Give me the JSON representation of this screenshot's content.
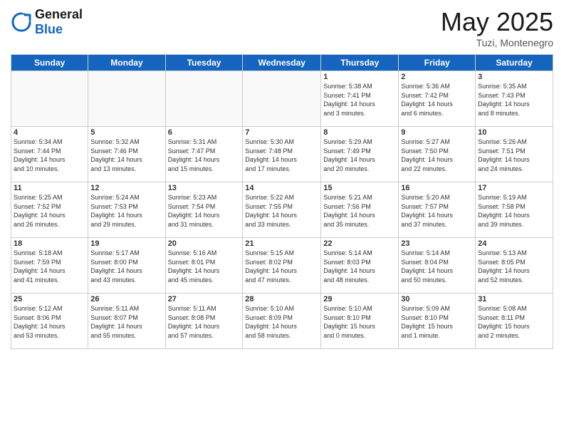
{
  "logo": {
    "general": "General",
    "blue": "Blue"
  },
  "title": "May 2025",
  "location": "Tuzi, Montenegro",
  "headers": [
    "Sunday",
    "Monday",
    "Tuesday",
    "Wednesday",
    "Thursday",
    "Friday",
    "Saturday"
  ],
  "weeks": [
    [
      {
        "day": "",
        "info": ""
      },
      {
        "day": "",
        "info": ""
      },
      {
        "day": "",
        "info": ""
      },
      {
        "day": "",
        "info": ""
      },
      {
        "day": "1",
        "info": "Sunrise: 5:38 AM\nSunset: 7:41 PM\nDaylight: 14 hours\nand 3 minutes."
      },
      {
        "day": "2",
        "info": "Sunrise: 5:36 AM\nSunset: 7:42 PM\nDaylight: 14 hours\nand 6 minutes."
      },
      {
        "day": "3",
        "info": "Sunrise: 5:35 AM\nSunset: 7:43 PM\nDaylight: 14 hours\nand 8 minutes."
      }
    ],
    [
      {
        "day": "4",
        "info": "Sunrise: 5:34 AM\nSunset: 7:44 PM\nDaylight: 14 hours\nand 10 minutes."
      },
      {
        "day": "5",
        "info": "Sunrise: 5:32 AM\nSunset: 7:46 PM\nDaylight: 14 hours\nand 13 minutes."
      },
      {
        "day": "6",
        "info": "Sunrise: 5:31 AM\nSunset: 7:47 PM\nDaylight: 14 hours\nand 15 minutes."
      },
      {
        "day": "7",
        "info": "Sunrise: 5:30 AM\nSunset: 7:48 PM\nDaylight: 14 hours\nand 17 minutes."
      },
      {
        "day": "8",
        "info": "Sunrise: 5:29 AM\nSunset: 7:49 PM\nDaylight: 14 hours\nand 20 minutes."
      },
      {
        "day": "9",
        "info": "Sunrise: 5:27 AM\nSunset: 7:50 PM\nDaylight: 14 hours\nand 22 minutes."
      },
      {
        "day": "10",
        "info": "Sunrise: 5:26 AM\nSunset: 7:51 PM\nDaylight: 14 hours\nand 24 minutes."
      }
    ],
    [
      {
        "day": "11",
        "info": "Sunrise: 5:25 AM\nSunset: 7:52 PM\nDaylight: 14 hours\nand 26 minutes."
      },
      {
        "day": "12",
        "info": "Sunrise: 5:24 AM\nSunset: 7:53 PM\nDaylight: 14 hours\nand 29 minutes."
      },
      {
        "day": "13",
        "info": "Sunrise: 5:23 AM\nSunset: 7:54 PM\nDaylight: 14 hours\nand 31 minutes."
      },
      {
        "day": "14",
        "info": "Sunrise: 5:22 AM\nSunset: 7:55 PM\nDaylight: 14 hours\nand 33 minutes."
      },
      {
        "day": "15",
        "info": "Sunrise: 5:21 AM\nSunset: 7:56 PM\nDaylight: 14 hours\nand 35 minutes."
      },
      {
        "day": "16",
        "info": "Sunrise: 5:20 AM\nSunset: 7:57 PM\nDaylight: 14 hours\nand 37 minutes."
      },
      {
        "day": "17",
        "info": "Sunrise: 5:19 AM\nSunset: 7:58 PM\nDaylight: 14 hours\nand 39 minutes."
      }
    ],
    [
      {
        "day": "18",
        "info": "Sunrise: 5:18 AM\nSunset: 7:59 PM\nDaylight: 14 hours\nand 41 minutes."
      },
      {
        "day": "19",
        "info": "Sunrise: 5:17 AM\nSunset: 8:00 PM\nDaylight: 14 hours\nand 43 minutes."
      },
      {
        "day": "20",
        "info": "Sunrise: 5:16 AM\nSunset: 8:01 PM\nDaylight: 14 hours\nand 45 minutes."
      },
      {
        "day": "21",
        "info": "Sunrise: 5:15 AM\nSunset: 8:02 PM\nDaylight: 14 hours\nand 47 minutes."
      },
      {
        "day": "22",
        "info": "Sunrise: 5:14 AM\nSunset: 8:03 PM\nDaylight: 14 hours\nand 48 minutes."
      },
      {
        "day": "23",
        "info": "Sunrise: 5:14 AM\nSunset: 8:04 PM\nDaylight: 14 hours\nand 50 minutes."
      },
      {
        "day": "24",
        "info": "Sunrise: 5:13 AM\nSunset: 8:05 PM\nDaylight: 14 hours\nand 52 minutes."
      }
    ],
    [
      {
        "day": "25",
        "info": "Sunrise: 5:12 AM\nSunset: 8:06 PM\nDaylight: 14 hours\nand 53 minutes."
      },
      {
        "day": "26",
        "info": "Sunrise: 5:11 AM\nSunset: 8:07 PM\nDaylight: 14 hours\nand 55 minutes."
      },
      {
        "day": "27",
        "info": "Sunrise: 5:11 AM\nSunset: 8:08 PM\nDaylight: 14 hours\nand 57 minutes."
      },
      {
        "day": "28",
        "info": "Sunrise: 5:10 AM\nSunset: 8:09 PM\nDaylight: 14 hours\nand 58 minutes."
      },
      {
        "day": "29",
        "info": "Sunrise: 5:10 AM\nSunset: 8:10 PM\nDaylight: 15 hours\nand 0 minutes."
      },
      {
        "day": "30",
        "info": "Sunrise: 5:09 AM\nSunset: 8:10 PM\nDaylight: 15 hours\nand 1 minute."
      },
      {
        "day": "31",
        "info": "Sunrise: 5:08 AM\nSunset: 8:11 PM\nDaylight: 15 hours\nand 2 minutes."
      }
    ]
  ]
}
